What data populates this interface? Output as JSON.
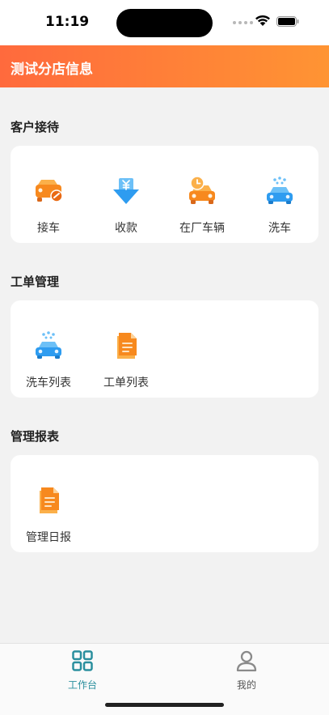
{
  "status_bar": {
    "time": "11:19"
  },
  "header": {
    "title": "测试分店信息"
  },
  "sections": [
    {
      "title": "客户接待",
      "items": [
        {
          "label": "接车",
          "icon": "car-pickup-icon"
        },
        {
          "label": "收款",
          "icon": "payment-icon"
        },
        {
          "label": "在厂车辆",
          "icon": "car-in-shop-icon"
        },
        {
          "label": "洗车",
          "icon": "car-wash-icon"
        }
      ]
    },
    {
      "title": "工单管理",
      "items": [
        {
          "label": "洗车列表",
          "icon": "car-wash-icon"
        },
        {
          "label": "工单列表",
          "icon": "document-icon"
        }
      ]
    },
    {
      "title": "管理报表",
      "items": [
        {
          "label": "管理日报",
          "icon": "document-icon"
        }
      ]
    }
  ],
  "tab_bar": {
    "tabs": [
      {
        "label": "工作台",
        "icon": "grid-icon",
        "active": true
      },
      {
        "label": "我的",
        "icon": "user-icon",
        "active": false
      }
    ]
  },
  "colors": {
    "header_start": "#ff6a3d",
    "header_end": "#ff9433",
    "icon_orange": "#f7891e",
    "icon_blue": "#2e9cf0",
    "tab_active": "#2a8f9e",
    "tab_inactive": "#8a8a8a"
  }
}
